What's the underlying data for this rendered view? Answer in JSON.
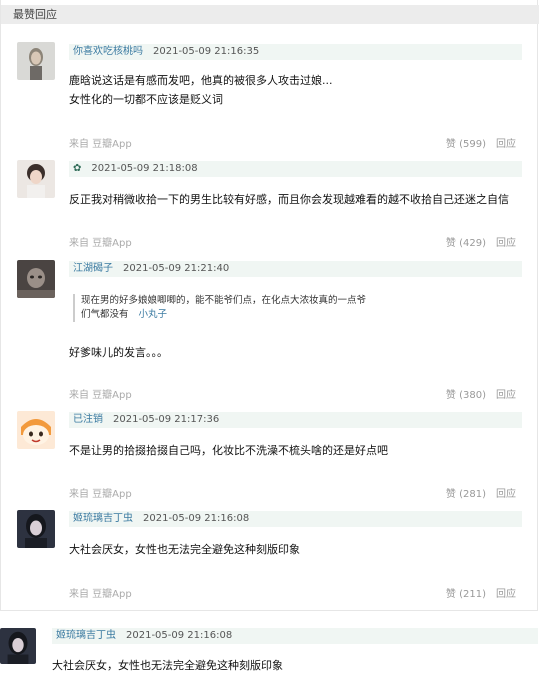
{
  "section": {
    "title": "最赞回应"
  },
  "comments": [
    {
      "user": "你喜欢吃核桃吗",
      "time": "2021-05-09 21:16:35",
      "lines": [
        "鹿晗说这话是有感而发吧，他真的被很多人攻击过娘...",
        "女性化的一切都不应该是贬义词"
      ],
      "from": "来自 豆瓣App",
      "like": "赞 (599)",
      "reply": "回应"
    },
    {
      "user": "",
      "time": "2021-05-09 21:18:08",
      "lines": [
        "反正我对稍微收拾一下的男生比较有好感，而且你会发现越难看的越不收拾自己还迷之自信"
      ],
      "from": "来自 豆瓣App",
      "like": "赞 (429)",
      "reply": "回应"
    },
    {
      "user": "江湖碣子",
      "time": "2021-05-09 21:21:40",
      "quote_line1": "现在男的好多娘娘唧唧的，能不能爷们点，在化点大浓妆真的一点爷",
      "quote_line2": "们气都没有",
      "quote_user": "小丸子",
      "lines": [
        "好爹味儿的发言。。。"
      ],
      "from": "来自 豆瓣App",
      "like": "赞 (380)",
      "reply": "回应"
    },
    {
      "user": "已注销",
      "time": "2021-05-09 21:17:36",
      "lines": [
        "不是让男的拾掇拾掇自己吗，化妆比不洗澡不梳头啥的还是好点吧"
      ],
      "from": "来自 豆瓣App",
      "like": "赞 (281)",
      "reply": "回应"
    },
    {
      "user": "姬琉璃吉丁虫",
      "time": "2021-05-09 21:16:08",
      "lines": [
        "大社会厌女，女性也无法完全避免这种刻版印象"
      ],
      "from": "来自 豆瓣App",
      "like": "赞 (211)",
      "reply": "回应"
    }
  ],
  "extra": {
    "user": "姬琉璃吉丁虫",
    "time": "2021-05-09 21:16:08",
    "text": "大社会厌女，女性也无法完全避免这种刻版印象"
  }
}
